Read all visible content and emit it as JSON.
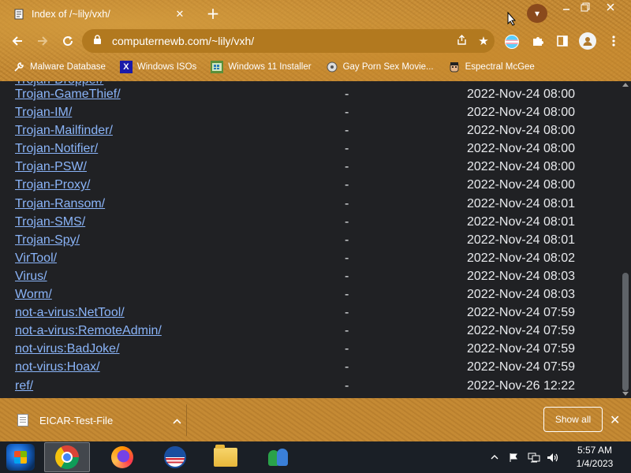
{
  "browser": {
    "tab": {
      "title": "Index of /~lily/vxh/",
      "favicon": "page-icon"
    },
    "url": "computernewb.com/~lily/vxh/",
    "theme_color": "#c58a34",
    "bookmarks": [
      {
        "label": "Malware Database",
        "icon": "wrench-icon"
      },
      {
        "label": "Windows ISOs",
        "icon": "x-icon"
      },
      {
        "label": "Windows 11 Installer",
        "icon": "windows-icon"
      },
      {
        "label": "Gay Porn Sex Movie...",
        "icon": "disc-icon"
      },
      {
        "label": "Espectral McGee",
        "icon": "face-icon"
      }
    ]
  },
  "listing": {
    "partial_top": "Trojan-Dropper/",
    "link_color": "#8ab4f8",
    "rows": [
      {
        "name": "Trojan-GameThief/",
        "size": "-",
        "date": "2022-Nov-24 08:00"
      },
      {
        "name": "Trojan-IM/",
        "size": "-",
        "date": "2022-Nov-24 08:00"
      },
      {
        "name": "Trojan-Mailfinder/",
        "size": "-",
        "date": "2022-Nov-24 08:00"
      },
      {
        "name": "Trojan-Notifier/",
        "size": "-",
        "date": "2022-Nov-24 08:00"
      },
      {
        "name": "Trojan-PSW/",
        "size": "-",
        "date": "2022-Nov-24 08:00"
      },
      {
        "name": "Trojan-Proxy/",
        "size": "-",
        "date": "2022-Nov-24 08:00"
      },
      {
        "name": "Trojan-Ransom/",
        "size": "-",
        "date": "2022-Nov-24 08:01"
      },
      {
        "name": "Trojan-SMS/",
        "size": "-",
        "date": "2022-Nov-24 08:01"
      },
      {
        "name": "Trojan-Spy/",
        "size": "-",
        "date": "2022-Nov-24 08:01"
      },
      {
        "name": "VirTool/",
        "size": "-",
        "date": "2022-Nov-24 08:02"
      },
      {
        "name": "Virus/",
        "size": "-",
        "date": "2022-Nov-24 08:03"
      },
      {
        "name": "Worm/",
        "size": "-",
        "date": "2022-Nov-24 08:03"
      },
      {
        "name": "not-a-virus:NetTool/",
        "size": "-",
        "date": "2022-Nov-24 07:59"
      },
      {
        "name": "not-a-virus:RemoteAdmin/",
        "size": "-",
        "date": "2022-Nov-24 07:59"
      },
      {
        "name": "not-virus:BadJoke/",
        "size": "-",
        "date": "2022-Nov-24 07:59"
      },
      {
        "name": "not-virus:Hoax/",
        "size": "-",
        "date": "2022-Nov-24 07:59"
      },
      {
        "name": "ref/",
        "size": "-",
        "date": "2022-Nov-26 12:22"
      }
    ]
  },
  "downloads": {
    "item": "EICAR-Test-File",
    "show_all": "Show all"
  },
  "taskbar": {
    "apps": [
      "Google Chrome",
      "Firefox",
      "Obama",
      "File Explorer",
      "Windows Live Messenger"
    ],
    "time": "5:57 AM",
    "date": "1/4/2023"
  }
}
